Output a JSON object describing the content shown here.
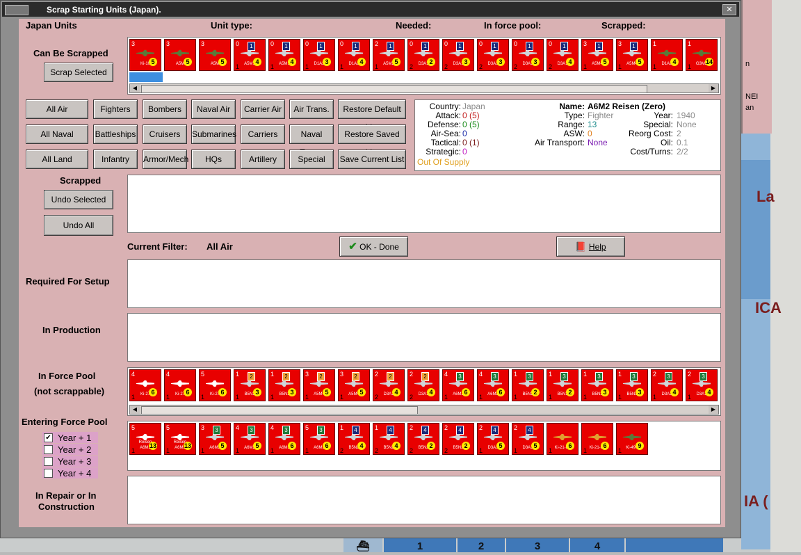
{
  "window": {
    "title": "Scrap Starting Units (Japan)."
  },
  "headers": {
    "units": "Japan Units",
    "unit_type": "Unit type:",
    "needed": "Needed:",
    "in_force_pool": "In force pool:",
    "scrapped": "Scrapped:"
  },
  "sections": {
    "can_be_scrapped": "Can Be Scrapped",
    "scrapped": "Scrapped",
    "required_setup": "Required For Setup",
    "in_production": "In Production",
    "in_force_pool_1": "In Force Pool",
    "in_force_pool_2": "(not scrappable)",
    "entering": "Entering Force Pool",
    "repair_1": "In Repair or In",
    "repair_2": "Construction"
  },
  "buttons": {
    "scrap_selected": "Scrap Selected",
    "undo_selected": "Undo Selected",
    "undo_all": "Undo All",
    "ok_done": "OK - Done",
    "help": "Help",
    "filters": [
      [
        "All Air",
        "Fighters",
        "Bombers",
        "Naval Air",
        "Carrier Air",
        "Air Trans.",
        "Restore Default List"
      ],
      [
        "All Naval",
        "Battleships",
        "Cruisers",
        "Submarines",
        "Carriers",
        "Naval Trans.",
        "Restore Saved List"
      ],
      [
        "All Land",
        "Infantry",
        "Armor/Mech",
        "HQs",
        "Artillery",
        "Special",
        "Save Current List"
      ]
    ]
  },
  "filter": {
    "label": "Current Filter:",
    "value": "All Air"
  },
  "unit_info": {
    "country_label": "Country:",
    "country": "Japan",
    "attack_label": "Attack:",
    "attack": "0 (5)",
    "defense_label": "Defense:",
    "defense": "0 (5)",
    "airsea_label": "Air-Sea:",
    "airsea": "0",
    "tactical_label": "Tactical:",
    "tactical": "0 (1)",
    "strategic_label": "Strategic:",
    "strategic": "0",
    "supply": "Out Of Supply",
    "name_label": "Name:",
    "name": "A6M2 Reisen (Zero)",
    "type_label": "Type:",
    "type": "Fighter",
    "range_label": "Range:",
    "range": "13",
    "asw_label": "ASW:",
    "asw": "0",
    "airtrans_label": "Air Transport:",
    "airtrans": "None",
    "year_label": "Year:",
    "year": "1940",
    "special_label": "Special:",
    "special": "None",
    "reorg_label": "Reorg Cost:",
    "reorg": "2",
    "oil_label": "Oil:",
    "oil": "0.1",
    "cost_label": "Cost/Turns:",
    "cost": "2/2"
  },
  "checkboxes": [
    {
      "label": "Year + 1",
      "checked": true
    },
    {
      "label": "Year + 2",
      "checked": false
    },
    {
      "label": "Year + 3",
      "checked": false
    },
    {
      "label": "Year + 4",
      "checked": false
    }
  ],
  "can_be_scrapped_units": [
    {
      "tl": "3",
      "name": "Ki-10",
      "flag": "",
      "circle": "5",
      "bl": "",
      "variant": "green-plane"
    },
    {
      "tl": "3",
      "name": "A5M",
      "flag": "",
      "circle": "5",
      "bl": "",
      "variant": "green-plane"
    },
    {
      "tl": "3",
      "name": "A5M",
      "flag": "",
      "circle": "5",
      "bl": "",
      "variant": "green-plane"
    },
    {
      "tl": "0",
      "name": "A5M1",
      "flag": "1",
      "circle": "4",
      "bl": "1",
      "variant": "navy"
    },
    {
      "tl": "0",
      "name": "A5M1",
      "flag": "1",
      "circle": "4",
      "bl": "1",
      "variant": "navy"
    },
    {
      "tl": "0",
      "name": "D1A2",
      "flag": "1",
      "circle": "3",
      "bl": "1",
      "variant": "navy"
    },
    {
      "tl": "0",
      "name": "D1A2",
      "flag": "1",
      "circle": "4",
      "bl": "1",
      "variant": "navy"
    },
    {
      "tl": "2",
      "name": "A5M2",
      "flag": "1",
      "circle": "5",
      "bl": "1",
      "variant": "navy"
    },
    {
      "tl": "0",
      "name": "D3A1",
      "flag": "1",
      "circle": "2",
      "bl": "2",
      "variant": "navy"
    },
    {
      "tl": "0",
      "name": "D3A1",
      "flag": "1",
      "circle": "3",
      "bl": "2",
      "variant": "navy"
    },
    {
      "tl": "0",
      "name": "D3A1",
      "flag": "1",
      "circle": "3",
      "bl": "2",
      "variant": "navy"
    },
    {
      "tl": "0",
      "name": "D3A1",
      "flag": "1",
      "circle": "3",
      "bl": "2",
      "variant": "navy"
    },
    {
      "tl": "0",
      "name": "D3A1",
      "flag": "1",
      "circle": "4",
      "bl": "2",
      "variant": "navy"
    },
    {
      "tl": "3",
      "name": "A5M4",
      "flag": "1",
      "circle": "5",
      "bl": "1",
      "variant": "navy"
    },
    {
      "tl": "3",
      "name": "A5M4",
      "flag": "1",
      "circle": "5",
      "bl": "1",
      "variant": "navy"
    },
    {
      "tl": "1",
      "name": "D1A2",
      "flag": "",
      "circle": "4",
      "bl": "1",
      "variant": "green-plane"
    },
    {
      "tl": "1",
      "name": "G3M2",
      "flag": "",
      "circle": "14",
      "bl": "1",
      "variant": "green-plane"
    }
  ],
  "force_pool_units": [
    {
      "tl": "4",
      "name": "Ki-27",
      "flag": "",
      "circle": "6",
      "bl": "1",
      "variant": "white"
    },
    {
      "tl": "4",
      "name": "Ki-27",
      "flag": "",
      "circle": "6",
      "bl": "1",
      "variant": "white"
    },
    {
      "tl": "5",
      "name": "Ki-27",
      "flag": "",
      "circle": "6",
      "bl": "1",
      "variant": "white"
    },
    {
      "tl": "1",
      "name": "B5N1",
      "flag": "2",
      "circle": "3",
      "bl": "1",
      "variant": "orange"
    },
    {
      "tl": "1",
      "name": "B5N1",
      "flag": "2",
      "circle": "3",
      "bl": "1",
      "variant": "orange"
    },
    {
      "tl": "3",
      "name": "A5M4",
      "flag": "2",
      "circle": "5",
      "bl": "1",
      "variant": "orange"
    },
    {
      "tl": "3",
      "name": "A5M4",
      "flag": "2",
      "circle": "5",
      "bl": "1",
      "variant": "orange"
    },
    {
      "tl": "2",
      "name": "D3A1",
      "flag": "2",
      "circle": "4",
      "bl": "2",
      "variant": "orange"
    },
    {
      "tl": "2",
      "name": "D3A1",
      "flag": "2",
      "circle": "4",
      "bl": "2",
      "variant": "orange"
    },
    {
      "tl": "4",
      "name": "A6M2",
      "flag": "3",
      "circle": "6",
      "bl": "1",
      "variant": "green"
    },
    {
      "tl": "4",
      "name": "A6M2",
      "flag": "3",
      "circle": "6",
      "bl": "1",
      "variant": "green"
    },
    {
      "tl": "1",
      "name": "B5N1",
      "flag": "3",
      "circle": "2",
      "bl": "1",
      "variant": "green"
    },
    {
      "tl": "1",
      "name": "B5N1",
      "flag": "3",
      "circle": "2",
      "bl": "1",
      "variant": "green"
    },
    {
      "tl": "1",
      "name": "B5N1",
      "flag": "3",
      "circle": "3",
      "bl": "1",
      "variant": "green"
    },
    {
      "tl": "1",
      "name": "B5N1",
      "flag": "3",
      "circle": "3",
      "bl": "1",
      "variant": "green"
    },
    {
      "tl": "2",
      "name": "D3A1",
      "flag": "3",
      "circle": "4",
      "bl": "1",
      "variant": "green"
    },
    {
      "tl": "2",
      "name": "D3A1",
      "flag": "3",
      "circle": "4",
      "bl": "1",
      "variant": "green"
    }
  ],
  "entering_units": [
    {
      "tl": "5",
      "name": "A6M2",
      "sub": "Reisen",
      "flag": "",
      "circle": "13",
      "bl": "1",
      "variant": "white"
    },
    {
      "tl": "5",
      "name": "A6M2",
      "sub": "Reisen",
      "flag": "",
      "circle": "13",
      "bl": "1",
      "variant": "white"
    },
    {
      "tl": "3",
      "name": "A6M2",
      "flag": "3",
      "circle": "5",
      "bl": "1",
      "variant": "green"
    },
    {
      "tl": "4",
      "name": "A6M2",
      "flag": "3",
      "circle": "5",
      "bl": "1",
      "variant": "green"
    },
    {
      "tl": "4",
      "name": "A6M3",
      "flag": "3",
      "circle": "6",
      "bl": "1",
      "variant": "green"
    },
    {
      "tl": "5",
      "name": "A6M3",
      "flag": "3",
      "circle": "6",
      "bl": "1",
      "variant": "green"
    },
    {
      "tl": "1",
      "name": "B5N2",
      "flag": "4",
      "circle": "4",
      "bl": "2",
      "variant": "navy"
    },
    {
      "tl": "1",
      "name": "B5N2",
      "flag": "4",
      "circle": "4",
      "bl": "2",
      "variant": "navy"
    },
    {
      "tl": "2",
      "name": "B5N2",
      "flag": "4",
      "circle": "2",
      "bl": "2",
      "variant": "navy"
    },
    {
      "tl": "2",
      "name": "B5N2",
      "flag": "4",
      "circle": "2",
      "bl": "2",
      "variant": "navy"
    },
    {
      "tl": "2",
      "name": "D3A1",
      "flag": "4",
      "circle": "5",
      "bl": "1",
      "variant": "navy"
    },
    {
      "tl": "2",
      "name": "D3A1",
      "flag": "4",
      "circle": "5",
      "bl": "1",
      "variant": "navy"
    },
    {
      "tl": "",
      "name": "Ki-21-IIa",
      "flag": "",
      "circle": "6",
      "bl": "1",
      "variant": "orange-plane"
    },
    {
      "tl": "",
      "name": "Ki-21-IIb",
      "flag": "",
      "circle": "6",
      "bl": "1",
      "variant": "orange-plane"
    },
    {
      "tl": "",
      "name": "Ki-49-I",
      "flag": "",
      "circle": "9",
      "bl": "1",
      "variant": "green-plane"
    }
  ],
  "map": {
    "label_la": "La",
    "label_ica": "ICA",
    "label_ia": "IA (",
    "label_nei": "NEI",
    "label_an": "an",
    "label_n": "n"
  },
  "bottom_tabs": [
    "1",
    "2",
    "3",
    "4"
  ],
  "colors": {
    "window_bg": "#d9b1b3",
    "counter_red": "#e80000",
    "title_bar": "#2b2b2b"
  }
}
